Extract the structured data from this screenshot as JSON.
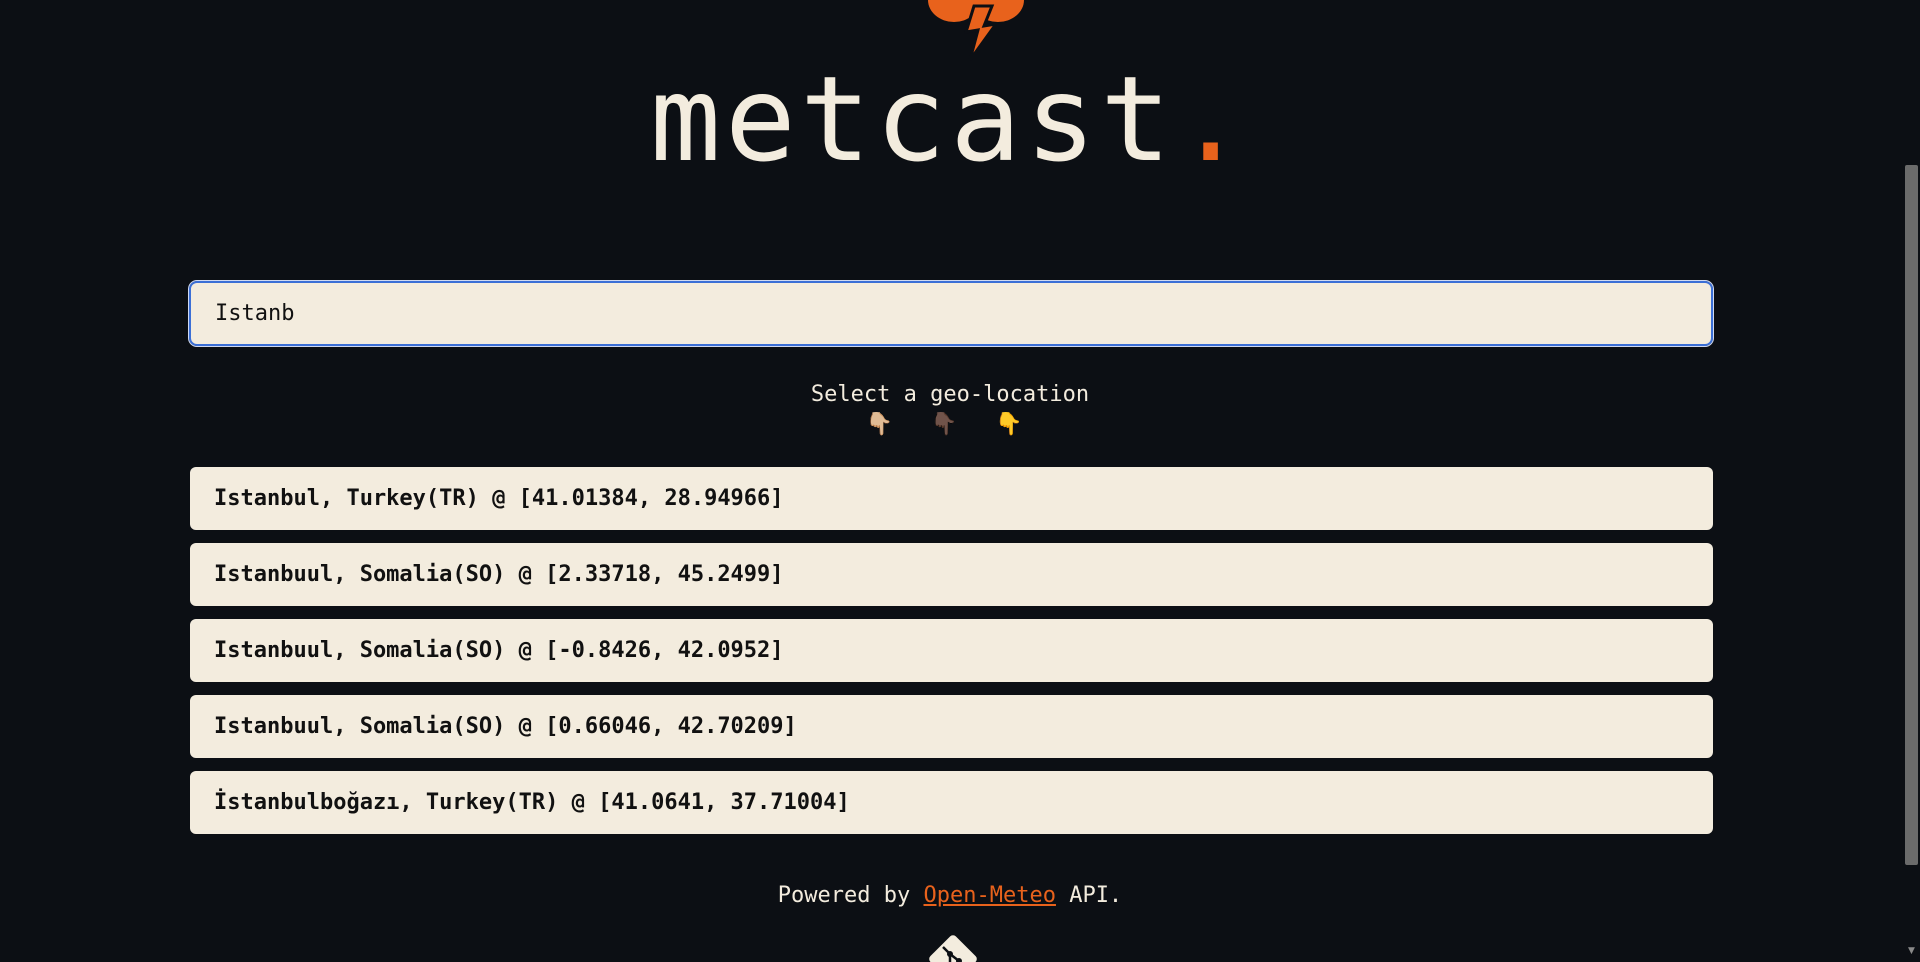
{
  "brand": {
    "name": "metcast",
    "dot": "."
  },
  "search": {
    "value": "Istanb"
  },
  "prompt": {
    "text": "Select a geo-location"
  },
  "hands": [
    "👇🏼",
    "👇🏿",
    "👇"
  ],
  "results": [
    "Istanbul, Turkey(TR) @ [41.01384, 28.94966]",
    "Istanbuul, Somalia(SO) @ [2.33718, 45.2499]",
    "Istanbuul, Somalia(SO) @ [-0.8426, 42.0952]",
    "Istanbuul, Somalia(SO) @ [0.66046, 42.70209]",
    "İstanbulboğazı, Turkey(TR) @ [41.0641, 37.71004]"
  ],
  "footer": {
    "prefix": "Powered by ",
    "link": "Open-Meteo",
    "suffix": " API."
  },
  "icons": {
    "logo": "storm-cloud-lightning-icon",
    "repo": "git-icon",
    "scroll_down": "chevron-down-icon"
  },
  "colors": {
    "background": "#0c0f14",
    "accent": "#e8621c",
    "card": "#f3ecde",
    "focus_border": "#3b6fd6"
  }
}
